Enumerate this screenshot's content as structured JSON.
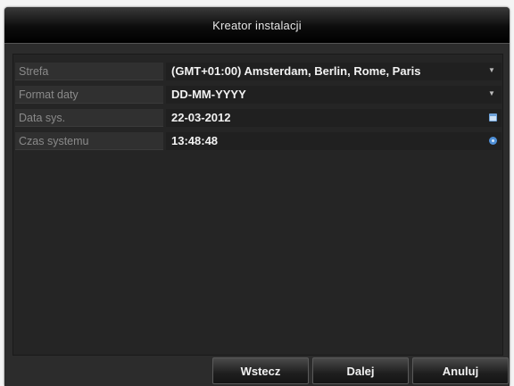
{
  "dialog": {
    "title": "Kreator instalacji"
  },
  "form": {
    "rows": [
      {
        "label": "Strefa",
        "value": "(GMT+01:00) Amsterdam, Berlin, Rome, Paris",
        "control": "dropdown"
      },
      {
        "label": "Format daty",
        "value": "DD-MM-YYYY",
        "control": "dropdown"
      },
      {
        "label": "Data sys.",
        "value": "22-03-2012",
        "control": "calendar"
      },
      {
        "label": "Czas systemu",
        "value": "13:48:48",
        "control": "clock"
      }
    ]
  },
  "buttons": {
    "back": "Wstecz",
    "next": "Dalej",
    "cancel": "Anuluj"
  },
  "icons": {
    "dropdown": "chevron-down-icon",
    "calendar": "calendar-icon",
    "clock": "clock-icon"
  },
  "colors": {
    "icon_accent": "#4f8fd6"
  }
}
